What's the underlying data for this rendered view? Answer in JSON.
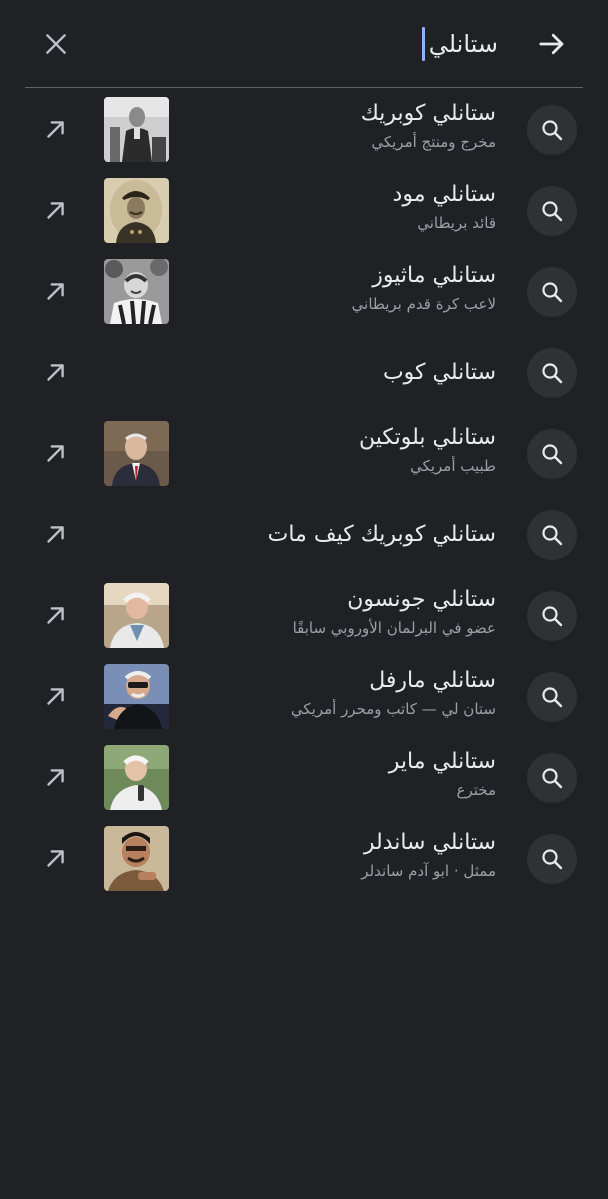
{
  "search": {
    "query": "ستانلي",
    "close_icon": "close-icon",
    "submit_icon": "arrow-right-icon"
  },
  "suggestions": [
    {
      "title": "ستانلي كوبريك",
      "subtitle": "مخرج ومنتج أمريكي",
      "thumbnail": "stanley-kubrick-photo"
    },
    {
      "title": "ستانلي مود",
      "subtitle": "قائد بريطاني",
      "thumbnail": "stanley-maude-photo"
    },
    {
      "title": "ستانلي ماثيوز",
      "subtitle": "لاعب كرة قدم بريطاني",
      "thumbnail": "stanley-matthews-photo"
    },
    {
      "title": "ستانلي كوب",
      "subtitle": "",
      "thumbnail": ""
    },
    {
      "title": "ستانلي بلوتكين",
      "subtitle": "طبيب أمريكي",
      "thumbnail": "stanley-plotkin-photo"
    },
    {
      "title": "ستانلي كوبريك كيف مات",
      "subtitle": "",
      "thumbnail": ""
    },
    {
      "title": "ستانلي جونسون",
      "subtitle": "عضو في البرلمان الأوروبي سابقًا",
      "thumbnail": "stanley-johnson-photo"
    },
    {
      "title": "ستانلي مارفل",
      "subtitle": "ستان لي — كاتب ومحرر أمريكي",
      "thumbnail": "stan-lee-photo"
    },
    {
      "title": "ستانلي ماير",
      "subtitle": "مخترع",
      "thumbnail": "stanley-meyer-photo"
    },
    {
      "title": "ستانلي ساندلر",
      "subtitle": "ممثل · ابو آدم ساندلر",
      "thumbnail": "stanley-sandler-photo"
    }
  ],
  "colors": {
    "background": "#202124",
    "text_primary": "#e8eaed",
    "text_secondary": "#9aa0a6",
    "caret": "#8ab4f8",
    "icon_circle": "#303134"
  }
}
